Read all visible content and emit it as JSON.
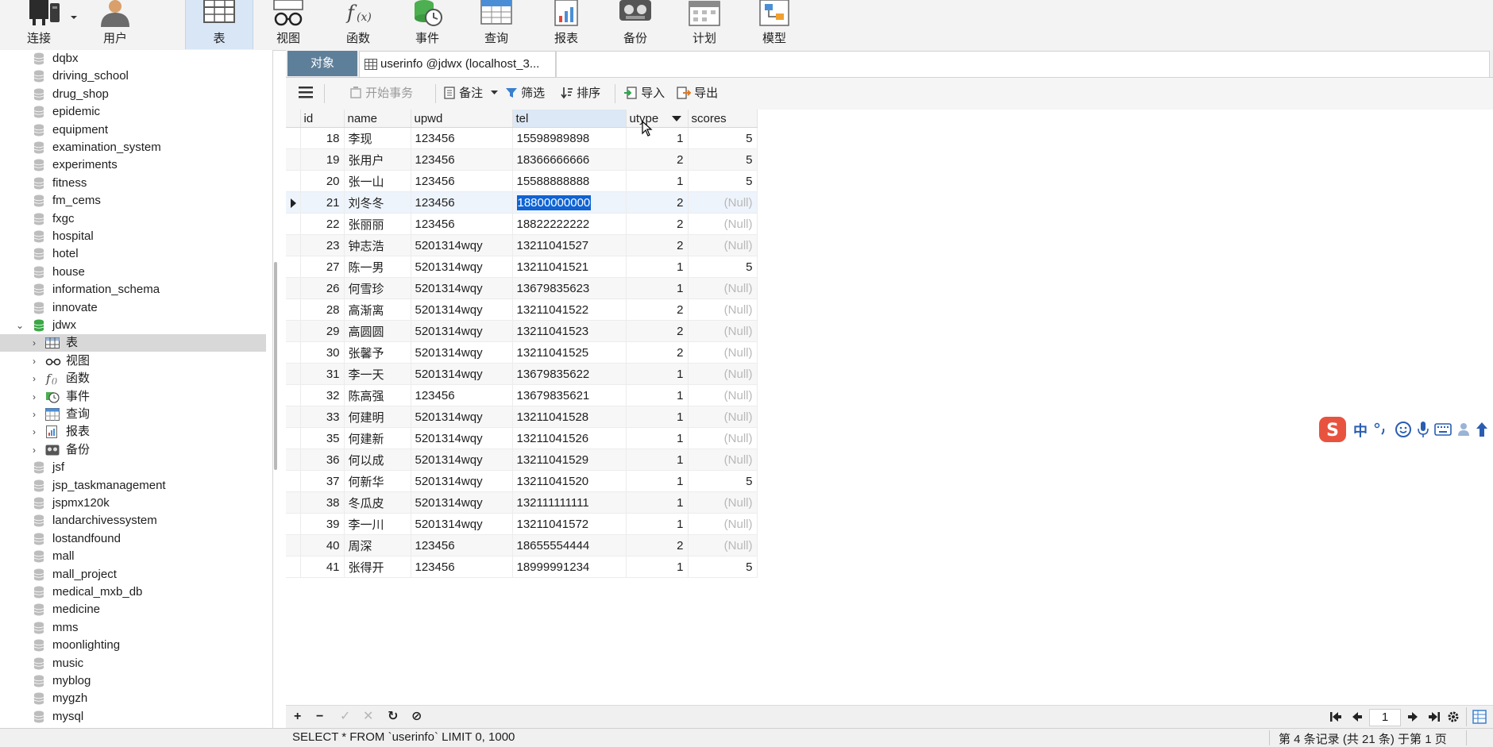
{
  "ribbon": [
    {
      "name": "connect-button",
      "icon": "plug-icon",
      "label": "连接"
    },
    {
      "name": "user-button",
      "icon": "user-icon",
      "label": "用户"
    },
    {
      "name": "table-button",
      "icon": "table-icon",
      "label": "表"
    },
    {
      "name": "view-button",
      "icon": "glasses-icon",
      "label": "视图"
    },
    {
      "name": "function-button",
      "icon": "function-icon",
      "label": "函数"
    },
    {
      "name": "event-button",
      "icon": "event-clock-icon",
      "label": "事件"
    },
    {
      "name": "query-button",
      "icon": "query-grid-icon",
      "label": "查询"
    },
    {
      "name": "report-button",
      "icon": "report-icon",
      "label": "报表"
    },
    {
      "name": "backup-button",
      "icon": "backup-icon",
      "label": "备份"
    },
    {
      "name": "schedule-button",
      "icon": "calendar-icon",
      "label": "计划"
    },
    {
      "name": "model-button",
      "icon": "model-icon",
      "label": "模型"
    }
  ],
  "tree": {
    "databases_before": [
      "dqbx",
      "driving_school",
      "drug_shop",
      "epidemic",
      "equipment",
      "examination_system",
      "experiments",
      "fitness",
      "fm_cems",
      "fxgc",
      "hospital",
      "hotel",
      "house",
      "information_schema",
      "innovate"
    ],
    "open_db": "jdwx",
    "children": [
      {
        "label": "表",
        "icon": "table-icon"
      },
      {
        "label": "视图",
        "icon": "glasses-icon"
      },
      {
        "label": "函数",
        "icon": "function-icon"
      },
      {
        "label": "事件",
        "icon": "event-clock-icon"
      },
      {
        "label": "查询",
        "icon": "query-grid-icon"
      },
      {
        "label": "报表",
        "icon": "report-icon"
      },
      {
        "label": "备份",
        "icon": "backup-icon"
      }
    ],
    "databases_after": [
      "jsf",
      "jsp_taskmanagement",
      "jspmx120k",
      "landarchivessystem",
      "lostandfound",
      "mall",
      "mall_project",
      "medical_mxb_db",
      "medicine",
      "mms",
      "moonlighting",
      "music",
      "myblog",
      "mygzh",
      "mysql"
    ]
  },
  "tabs": {
    "objects": "对象",
    "userinfo": "userinfo @jdwx (localhost_3..."
  },
  "toolbar": {
    "begin_transaction": "开始事务",
    "memo": "备注",
    "filter": "筛选",
    "sort": "排序",
    "import": "导入",
    "export": "导出"
  },
  "grid": {
    "columns": [
      "id",
      "name",
      "upwd",
      "tel",
      "utype",
      "scores"
    ],
    "null_text": "(Null)",
    "rows": [
      {
        "id": "18",
        "name": "李现",
        "upwd": "123456",
        "tel": "15598989898",
        "utype": "1",
        "scores": "5"
      },
      {
        "id": "19",
        "name": "张用户",
        "upwd": "123456",
        "tel": "18366666666",
        "utype": "2",
        "scores": "5"
      },
      {
        "id": "20",
        "name": "张一山",
        "upwd": "123456",
        "tel": "15588888888",
        "utype": "1",
        "scores": "5"
      },
      {
        "id": "21",
        "name": "刘冬冬",
        "upwd": "123456",
        "tel": "18800000000",
        "utype": "2",
        "scores": null
      },
      {
        "id": "22",
        "name": "张丽丽",
        "upwd": "123456",
        "tel": "18822222222",
        "utype": "2",
        "scores": null
      },
      {
        "id": "23",
        "name": "钟志浩",
        "upwd": "5201314wqy",
        "tel": "13211041527",
        "utype": "2",
        "scores": null
      },
      {
        "id": "27",
        "name": "陈一男",
        "upwd": "5201314wqy",
        "tel": "13211041521",
        "utype": "1",
        "scores": "5"
      },
      {
        "id": "26",
        "name": "何雪珍",
        "upwd": "5201314wqy",
        "tel": "13679835623",
        "utype": "1",
        "scores": null
      },
      {
        "id": "28",
        "name": "高渐离",
        "upwd": "5201314wqy",
        "tel": "13211041522",
        "utype": "2",
        "scores": null
      },
      {
        "id": "29",
        "name": "高圆圆",
        "upwd": "5201314wqy",
        "tel": "13211041523",
        "utype": "2",
        "scores": null
      },
      {
        "id": "30",
        "name": "张馨予",
        "upwd": "5201314wqy",
        "tel": "13211041525",
        "utype": "2",
        "scores": null
      },
      {
        "id": "31",
        "name": "李一天",
        "upwd": "5201314wqy",
        "tel": "13679835622",
        "utype": "1",
        "scores": null
      },
      {
        "id": "32",
        "name": "陈高强",
        "upwd": "123456",
        "tel": "13679835621",
        "utype": "1",
        "scores": null
      },
      {
        "id": "33",
        "name": "何建明",
        "upwd": "5201314wqy",
        "tel": "13211041528",
        "utype": "1",
        "scores": null
      },
      {
        "id": "35",
        "name": "何建新",
        "upwd": "5201314wqy",
        "tel": "13211041526",
        "utype": "1",
        "scores": null
      },
      {
        "id": "36",
        "name": "何以成",
        "upwd": "5201314wqy",
        "tel": "13211041529",
        "utype": "1",
        "scores": null
      },
      {
        "id": "37",
        "name": "何新华",
        "upwd": "5201314wqy",
        "tel": "13211041520",
        "utype": "1",
        "scores": "5"
      },
      {
        "id": "38",
        "name": "冬瓜皮",
        "upwd": "5201314wqy",
        "tel": "132111111111",
        "utype": "1",
        "scores": null
      },
      {
        "id": "39",
        "name": "李一川",
        "upwd": "5201314wqy",
        "tel": "13211041572",
        "utype": "1",
        "scores": null
      },
      {
        "id": "40",
        "name": "周深",
        "upwd": "123456",
        "tel": "18655554444",
        "utype": "2",
        "scores": null
      },
      {
        "id": "41",
        "name": "张得开",
        "upwd": "123456",
        "tel": "18999991234",
        "utype": "1",
        "scores": "5"
      }
    ]
  },
  "bottombar": {
    "add": "+",
    "delete": "−",
    "apply": "✓",
    "discard": "✕",
    "refresh": "↻",
    "stop": "⊘",
    "page": "1"
  },
  "status": {
    "sql": "SELECT * FROM `userinfo` LIMIT 0, 1000",
    "record_info": "第 4 条记录 (共 21 条) 于第 1 页"
  },
  "ime": {
    "mode": "中"
  },
  "colors": {
    "accent": "#0f63d4",
    "objects_tab": "#5e7f99",
    "db_open": "#3aa745"
  }
}
